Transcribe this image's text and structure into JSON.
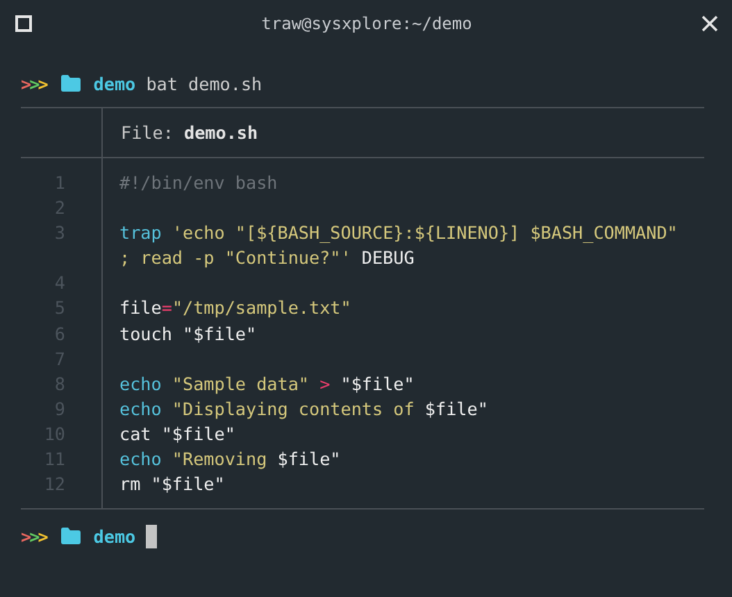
{
  "window": {
    "title": "traw@sysxplore:~/demo"
  },
  "prompts": [
    {
      "arrows": [
        {
          "text": ">",
          "color": "#e8675f"
        },
        {
          "text": ">",
          "color": "#62c962"
        },
        {
          "text": ">",
          "color": "#f2c230"
        }
      ],
      "directory": "demo",
      "command": "bat demo.sh",
      "cursor": false
    },
    {
      "arrows": [
        {
          "text": ">",
          "color": "#e8675f"
        },
        {
          "text": ">",
          "color": "#62c962"
        },
        {
          "text": ">",
          "color": "#f2c230"
        }
      ],
      "directory": "demo",
      "cursor": true
    }
  ],
  "file_view": {
    "header": "File: **demo.sh**",
    "lines": [
      {
        "number": "1",
        "rows": [
          [
            {
              "kind": "comment",
              "text": "#!/bin/env bash"
            }
          ]
        ]
      },
      {
        "number": "2"
      },
      {
        "number": "3",
        "rows": [
          [
            {
              "kind": "keyword",
              "text": "trap"
            },
            {
              "kind": "string",
              "text": " 'echo \"[${BASH_SOURCE}:${LINENO}] $BASH_COMMAND\""
            }
          ],
          [
            {
              "kind": "string",
              "text": "; read -p \"Continue?\"'"
            },
            {
              "kind": "plain",
              "text": " DEBUG"
            }
          ]
        ]
      },
      {
        "number": "4"
      },
      {
        "number": "5",
        "rows": [
          [
            {
              "kind": "plain",
              "text": "file"
            },
            {
              "kind": "operator",
              "text": "="
            },
            {
              "kind": "string",
              "text": "\"/tmp/sample.txt\""
            }
          ]
        ]
      },
      {
        "number": "6",
        "rows": [
          [
            {
              "kind": "plain",
              "text": "touch \"$file\""
            }
          ]
        ]
      },
      {
        "number": "7"
      },
      {
        "number": "8",
        "rows": [
          [
            {
              "kind": "keyword",
              "text": "echo"
            },
            {
              "kind": "string",
              "text": " \"Sample data\""
            },
            {
              "kind": "operator",
              "text": " >"
            },
            {
              "kind": "plain",
              "text": " \"$file\""
            }
          ]
        ]
      },
      {
        "number": "9",
        "rows": [
          [
            {
              "kind": "keyword",
              "text": "echo"
            },
            {
              "kind": "string",
              "text": " \"Displaying contents of "
            },
            {
              "kind": "plain",
              "text": "$file\""
            }
          ]
        ]
      },
      {
        "number": "10",
        "rows": [
          [
            {
              "kind": "plain",
              "text": "cat \"$file\""
            }
          ]
        ]
      },
      {
        "number": "11",
        "rows": [
          [
            {
              "kind": "keyword",
              "text": "echo"
            },
            {
              "kind": "string",
              "text": " \"Removing "
            },
            {
              "kind": "plain",
              "text": "$file\""
            }
          ]
        ]
      },
      {
        "number": "12",
        "rows": [
          [
            {
              "kind": "plain",
              "text": "rm \"$file\""
            }
          ]
        ]
      }
    ]
  }
}
